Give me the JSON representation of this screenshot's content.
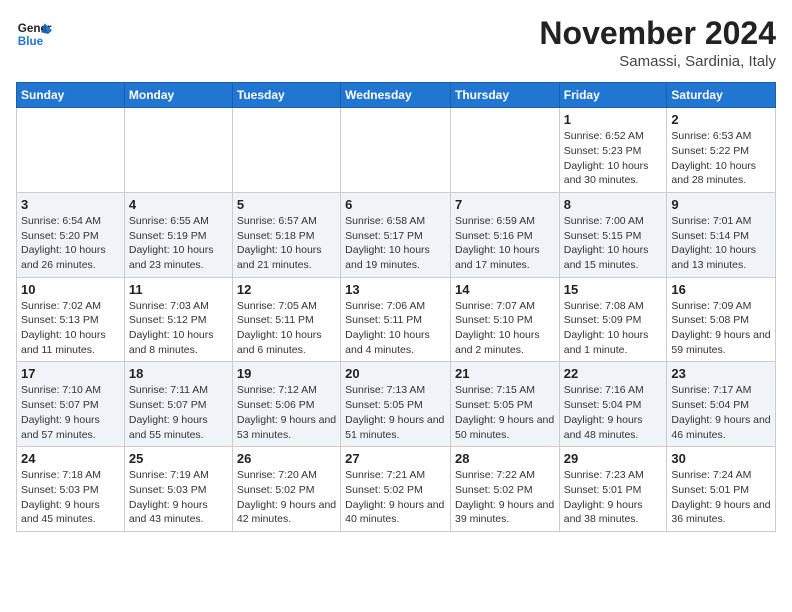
{
  "header": {
    "logo_line1": "General",
    "logo_line2": "Blue",
    "month": "November 2024",
    "location": "Samassi, Sardinia, Italy"
  },
  "weekdays": [
    "Sunday",
    "Monday",
    "Tuesday",
    "Wednesday",
    "Thursday",
    "Friday",
    "Saturday"
  ],
  "weeks": [
    [
      {
        "day": "",
        "info": ""
      },
      {
        "day": "",
        "info": ""
      },
      {
        "day": "",
        "info": ""
      },
      {
        "day": "",
        "info": ""
      },
      {
        "day": "",
        "info": ""
      },
      {
        "day": "1",
        "info": "Sunrise: 6:52 AM\nSunset: 5:23 PM\nDaylight: 10 hours and 30 minutes."
      },
      {
        "day": "2",
        "info": "Sunrise: 6:53 AM\nSunset: 5:22 PM\nDaylight: 10 hours and 28 minutes."
      }
    ],
    [
      {
        "day": "3",
        "info": "Sunrise: 6:54 AM\nSunset: 5:20 PM\nDaylight: 10 hours and 26 minutes."
      },
      {
        "day": "4",
        "info": "Sunrise: 6:55 AM\nSunset: 5:19 PM\nDaylight: 10 hours and 23 minutes."
      },
      {
        "day": "5",
        "info": "Sunrise: 6:57 AM\nSunset: 5:18 PM\nDaylight: 10 hours and 21 minutes."
      },
      {
        "day": "6",
        "info": "Sunrise: 6:58 AM\nSunset: 5:17 PM\nDaylight: 10 hours and 19 minutes."
      },
      {
        "day": "7",
        "info": "Sunrise: 6:59 AM\nSunset: 5:16 PM\nDaylight: 10 hours and 17 minutes."
      },
      {
        "day": "8",
        "info": "Sunrise: 7:00 AM\nSunset: 5:15 PM\nDaylight: 10 hours and 15 minutes."
      },
      {
        "day": "9",
        "info": "Sunrise: 7:01 AM\nSunset: 5:14 PM\nDaylight: 10 hours and 13 minutes."
      }
    ],
    [
      {
        "day": "10",
        "info": "Sunrise: 7:02 AM\nSunset: 5:13 PM\nDaylight: 10 hours and 11 minutes."
      },
      {
        "day": "11",
        "info": "Sunrise: 7:03 AM\nSunset: 5:12 PM\nDaylight: 10 hours and 8 minutes."
      },
      {
        "day": "12",
        "info": "Sunrise: 7:05 AM\nSunset: 5:11 PM\nDaylight: 10 hours and 6 minutes."
      },
      {
        "day": "13",
        "info": "Sunrise: 7:06 AM\nSunset: 5:11 PM\nDaylight: 10 hours and 4 minutes."
      },
      {
        "day": "14",
        "info": "Sunrise: 7:07 AM\nSunset: 5:10 PM\nDaylight: 10 hours and 2 minutes."
      },
      {
        "day": "15",
        "info": "Sunrise: 7:08 AM\nSunset: 5:09 PM\nDaylight: 10 hours and 1 minute."
      },
      {
        "day": "16",
        "info": "Sunrise: 7:09 AM\nSunset: 5:08 PM\nDaylight: 9 hours and 59 minutes."
      }
    ],
    [
      {
        "day": "17",
        "info": "Sunrise: 7:10 AM\nSunset: 5:07 PM\nDaylight: 9 hours and 57 minutes."
      },
      {
        "day": "18",
        "info": "Sunrise: 7:11 AM\nSunset: 5:07 PM\nDaylight: 9 hours and 55 minutes."
      },
      {
        "day": "19",
        "info": "Sunrise: 7:12 AM\nSunset: 5:06 PM\nDaylight: 9 hours and 53 minutes."
      },
      {
        "day": "20",
        "info": "Sunrise: 7:13 AM\nSunset: 5:05 PM\nDaylight: 9 hours and 51 minutes."
      },
      {
        "day": "21",
        "info": "Sunrise: 7:15 AM\nSunset: 5:05 PM\nDaylight: 9 hours and 50 minutes."
      },
      {
        "day": "22",
        "info": "Sunrise: 7:16 AM\nSunset: 5:04 PM\nDaylight: 9 hours and 48 minutes."
      },
      {
        "day": "23",
        "info": "Sunrise: 7:17 AM\nSunset: 5:04 PM\nDaylight: 9 hours and 46 minutes."
      }
    ],
    [
      {
        "day": "24",
        "info": "Sunrise: 7:18 AM\nSunset: 5:03 PM\nDaylight: 9 hours and 45 minutes."
      },
      {
        "day": "25",
        "info": "Sunrise: 7:19 AM\nSunset: 5:03 PM\nDaylight: 9 hours and 43 minutes."
      },
      {
        "day": "26",
        "info": "Sunrise: 7:20 AM\nSunset: 5:02 PM\nDaylight: 9 hours and 42 minutes."
      },
      {
        "day": "27",
        "info": "Sunrise: 7:21 AM\nSunset: 5:02 PM\nDaylight: 9 hours and 40 minutes."
      },
      {
        "day": "28",
        "info": "Sunrise: 7:22 AM\nSunset: 5:02 PM\nDaylight: 9 hours and 39 minutes."
      },
      {
        "day": "29",
        "info": "Sunrise: 7:23 AM\nSunset: 5:01 PM\nDaylight: 9 hours and 38 minutes."
      },
      {
        "day": "30",
        "info": "Sunrise: 7:24 AM\nSunset: 5:01 PM\nDaylight: 9 hours and 36 minutes."
      }
    ]
  ]
}
